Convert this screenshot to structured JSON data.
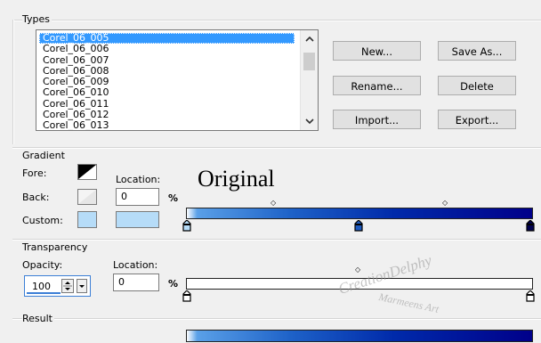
{
  "types": {
    "label": "Types",
    "items": [
      "Corel_06_005",
      "Corel_06_006",
      "Corel_06_007",
      "Corel_06_008",
      "Corel_06_009",
      "Corel_06_010",
      "Corel_06_011",
      "Corel_06_012",
      "Corel_06_013"
    ],
    "selected": "Corel_06_005",
    "buttons": {
      "new": "New...",
      "save_as": "Save As...",
      "rename": "Rename...",
      "delete": "Delete",
      "import": "Import...",
      "export": "Export..."
    }
  },
  "gradient": {
    "label": "Gradient",
    "fore_label": "Fore:",
    "back_label": "Back:",
    "custom_label": "Custom:",
    "location_label": "Location:",
    "location_value": "0",
    "percent": "%",
    "colors": {
      "custom": "#b6dcf8",
      "bar_start": "#ffffff",
      "bar_end": "#00008a"
    }
  },
  "overlay_text": "Original",
  "transparency": {
    "label": "Transparency",
    "opacity_label": "Opacity:",
    "opacity_value": "100",
    "location_label": "Location:",
    "location_value": "0",
    "percent": "%"
  },
  "watermark": {
    "line1": "CreationDelphy",
    "line2": "Marmeens Art"
  },
  "result": {
    "label": "Result"
  }
}
